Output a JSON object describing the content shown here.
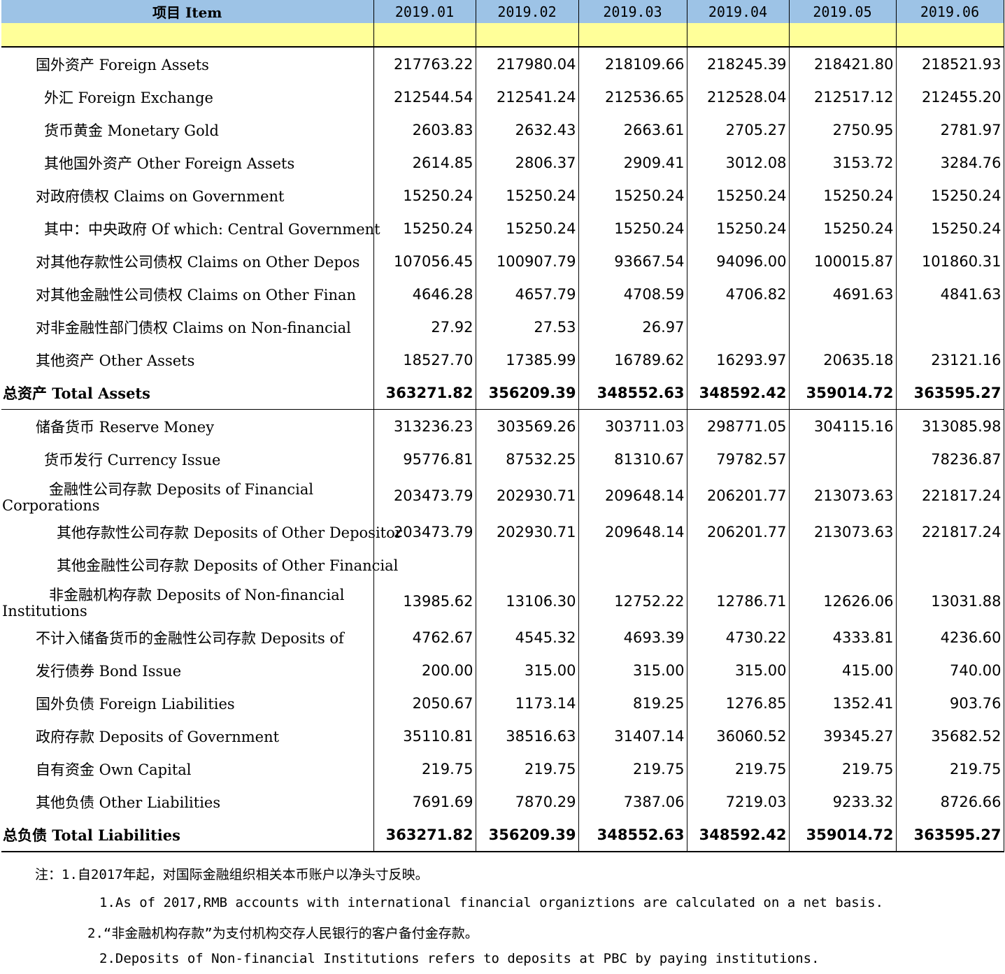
{
  "header": {
    "item_label": "项目 Item",
    "columns": [
      "2019.01",
      "2019.02",
      "2019.03",
      "2019.04",
      "2019.05",
      "2019.06"
    ]
  },
  "assets": [
    {
      "label": "国外资产  Foreign Assets",
      "indent": 1,
      "values": [
        "217763.22",
        "217980.04",
        "218109.66",
        "218245.39",
        "218421.80",
        "218521.93"
      ]
    },
    {
      "label": "外汇 Foreign Exchange",
      "indent": 2,
      "values": [
        "212544.54",
        "212541.24",
        "212536.65",
        "212528.04",
        "212517.12",
        "212455.20"
      ]
    },
    {
      "label": "货币黄金 Monetary Gold",
      "indent": 2,
      "values": [
        "2603.83",
        "2632.43",
        "2663.61",
        "2705.27",
        "2750.95",
        "2781.97"
      ]
    },
    {
      "label": "其他国外资产 Other Foreign Assets",
      "indent": 2,
      "values": [
        "2614.85",
        "2806.37",
        "2909.41",
        "3012.08",
        "3153.72",
        "3284.76"
      ]
    },
    {
      "label": "对政府债权 Claims on Government",
      "indent": 1,
      "values": [
        "15250.24",
        "15250.24",
        "15250.24",
        "15250.24",
        "15250.24",
        "15250.24"
      ]
    },
    {
      "label": "其中：中央政府 Of which: Central Government",
      "indent": 2,
      "values": [
        "15250.24",
        "15250.24",
        "15250.24",
        "15250.24",
        "15250.24",
        "15250.24"
      ]
    },
    {
      "label": "对其他存款性公司债权 Claims on Other Depos",
      "indent": 1,
      "values": [
        "107056.45",
        "100907.79",
        "93667.54",
        "94096.00",
        "100015.87",
        "101860.31"
      ]
    },
    {
      "label": "对其他金融性公司债权 Claims on Other Finan",
      "indent": 1,
      "values": [
        "4646.28",
        "4657.79",
        "4708.59",
        "4706.82",
        "4691.63",
        "4841.63"
      ]
    },
    {
      "label": "对非金融性部门债权 Claims on Non-financial",
      "indent": 1,
      "values": [
        "27.92",
        "27.53",
        "26.97",
        "",
        "",
        ""
      ]
    },
    {
      "label": "其他资产 Other Assets",
      "indent": 1,
      "values": [
        "18527.70",
        "17385.99",
        "16789.62",
        "16293.97",
        "20635.18",
        "23121.16"
      ]
    }
  ],
  "total_assets": {
    "label": "总资产 Total Assets",
    "values": [
      "363271.82",
      "356209.39",
      "348552.63",
      "348592.42",
      "359014.72",
      "363595.27"
    ]
  },
  "liabilities": [
    {
      "label": "储备货币 Reserve Money",
      "indent": 1,
      "values": [
        "313236.23",
        "303569.26",
        "303711.03",
        "298771.05",
        "304115.16",
        "313085.98"
      ]
    },
    {
      "label": "货币发行 Currency Issue",
      "indent": 2,
      "values": [
        "95776.81",
        "87532.25",
        "81310.67",
        "79782.57",
        "",
        "78236.87"
      ]
    },
    {
      "label_line1": "金融性公司存款 Deposits of Financial",
      "label_line2": "Corporations",
      "wrapped": true,
      "values": [
        "203473.79",
        "202930.71",
        "209648.14",
        "206201.77",
        "213073.63",
        "221817.24"
      ]
    },
    {
      "label": "其他存款性公司存款 Deposits of Other Depositor",
      "indent": 3,
      "values": [
        "203473.79",
        "202930.71",
        "209648.14",
        "206201.77",
        "213073.63",
        "221817.24"
      ]
    },
    {
      "label": "其他金融性公司存款 Deposits of Other Financial",
      "indent": 3,
      "values": [
        "",
        "",
        "",
        "",
        "",
        ""
      ]
    },
    {
      "label_line1": "非金融机构存款 Deposits of Non-financial",
      "label_line2": "Institutions",
      "wrapped": true,
      "values": [
        "13985.62",
        "13106.30",
        "12752.22",
        "12786.71",
        "12626.06",
        "13031.88"
      ]
    },
    {
      "label": "不计入储备货币的金融性公司存款 Deposits of",
      "indent": 1,
      "values": [
        "4762.67",
        "4545.32",
        "4693.39",
        "4730.22",
        "4333.81",
        "4236.60"
      ]
    },
    {
      "label": "发行债券 Bond Issue",
      "indent": 1,
      "values": [
        "200.00",
        "315.00",
        "315.00",
        "315.00",
        "415.00",
        "740.00"
      ]
    },
    {
      "label": "国外负债 Foreign Liabilities",
      "indent": 1,
      "values": [
        "2050.67",
        "1173.14",
        "819.25",
        "1276.85",
        "1352.41",
        "903.76"
      ]
    },
    {
      "label": "政府存款 Deposits of Government",
      "indent": 1,
      "values": [
        "35110.81",
        "38516.63",
        "31407.14",
        "36060.52",
        "39345.27",
        "35682.52"
      ]
    },
    {
      "label": "自有资金 Own Capital",
      "indent": 1,
      "values": [
        "219.75",
        "219.75",
        "219.75",
        "219.75",
        "219.75",
        "219.75"
      ]
    },
    {
      "label": "其他负债 Other Liabilities",
      "indent": 1,
      "values": [
        "7691.69",
        "7870.29",
        "7387.06",
        "7219.03",
        "9233.32",
        "8726.66"
      ]
    }
  ],
  "total_liabilities": {
    "label": "总负债 Total Liabilities",
    "values": [
      "363271.82",
      "356209.39",
      "348552.63",
      "348592.42",
      "359014.72",
      "363595.27"
    ]
  },
  "notes": [
    "注：1.自2017年起，对国际金融组织相关本币账户以净头寸反映。",
    "1.As of 2017,RMB accounts with international financial organiztions are calculated on a net basis.",
    "2.“非金融机构存款”为支付机构交存人民银行的客户备付金存款。",
    "2.Deposits of Non-financial Institutions refers to deposits at PBC by paying institutions."
  ],
  "colors": {
    "header_bg": "#9dc3e6",
    "band_bg": "#ffff99"
  }
}
